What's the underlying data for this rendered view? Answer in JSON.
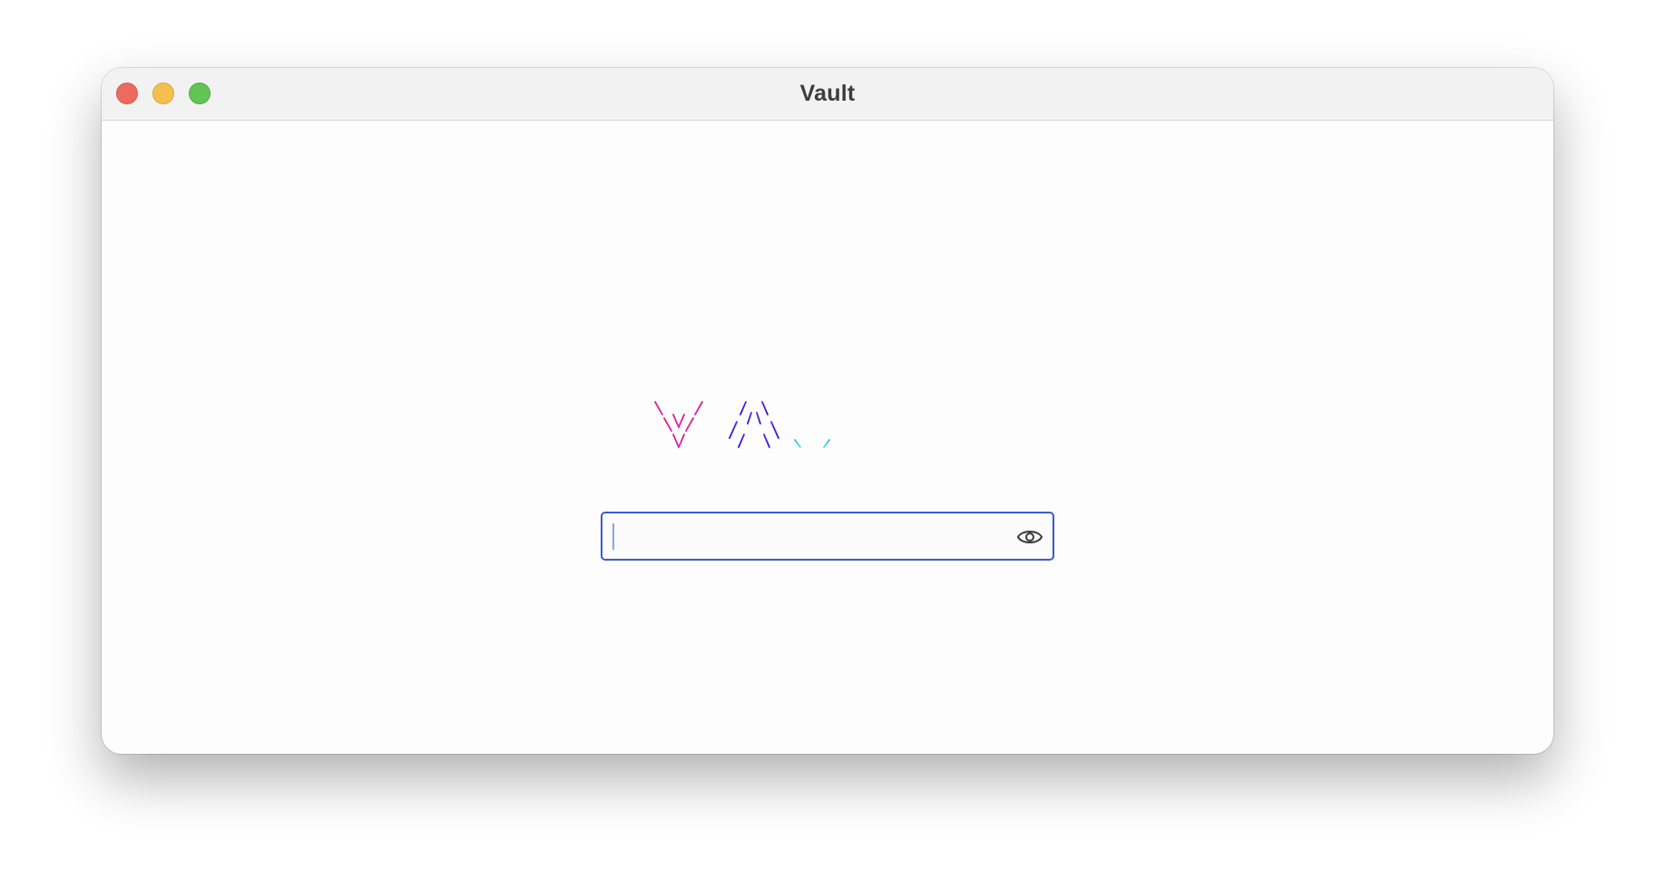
{
  "window": {
    "title": "Vault"
  },
  "logo": {
    "text": "VAULT",
    "letter_colors": [
      "#e8208f",
      "#3a1fe0",
      "#38d8f0",
      "#86f03c",
      "#f0a020"
    ]
  },
  "password_field": {
    "value": "",
    "placeholder": "",
    "toggle_icon": "eye-icon"
  },
  "colors": {
    "field_border": "#3b5bcc",
    "close": "#ed6a5e",
    "minimize": "#f5bf4f",
    "maximize": "#61c554"
  }
}
